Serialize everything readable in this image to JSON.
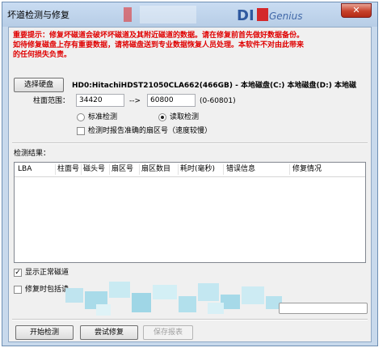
{
  "window": {
    "title": "坏道检测与修复",
    "close_glyph": "✕"
  },
  "warning": {
    "line1": "重要提示：修复坏磁道会破坏坏磁道及其附近磁道的数据。请在修复前首先做好数据备份。",
    "line2": "如待修复磁盘上存有重要数据，请将磁盘送到专业数据恢复人员处理。本软件不对由此带来",
    "line3": "的任何损失负责。"
  },
  "disk": {
    "select_label": "选择硬盘",
    "info": "HD0:HitachiHDST21050CLA662(466GB) - 本地磁盘(C:) 本地磁盘(D:) 本地磁"
  },
  "range": {
    "label": "柱面范围：",
    "start": "34420",
    "arrow": "-->",
    "end": "60800",
    "hint": "(0-60801)"
  },
  "mode": {
    "standard_label": "标准检测",
    "read_label": "读取检测",
    "selected": "read"
  },
  "options": {
    "report_sector_label": "检测时报告准确的扇区号（速度较慢）",
    "show_normal_label": "显示正常磁道",
    "show_normal_checked": true,
    "repair_include_label": "修复时包括读"
  },
  "results": {
    "label": "检测结果：",
    "columns": [
      "LBA",
      "柱面号",
      "磁头号",
      "扇区号",
      "扇区数目",
      "耗时(毫秒)",
      "错误信息",
      "修复情况"
    ]
  },
  "actions": {
    "start": "开始检测",
    "repair": "尝试修复",
    "save": "保存报表"
  }
}
